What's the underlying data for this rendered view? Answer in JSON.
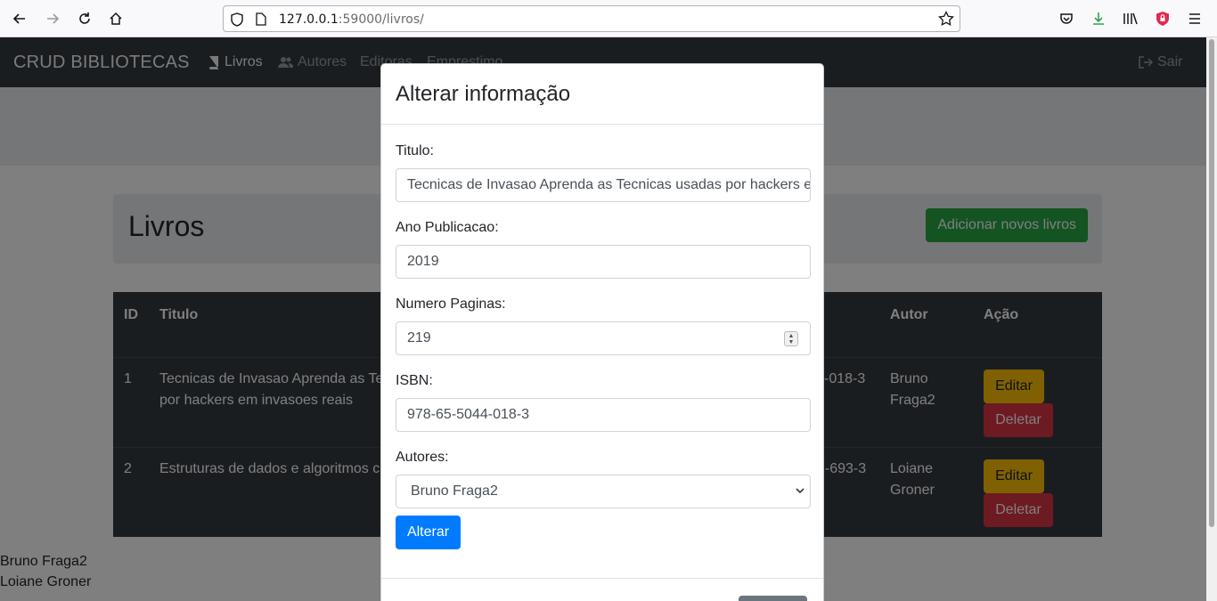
{
  "browser": {
    "url_host": "127.0.0.1",
    "url_rest": ":59000/livros/"
  },
  "navbar": {
    "brand": "CRUD BIBLIOTECAS",
    "links": [
      {
        "label": "Livros",
        "icon": "book-icon",
        "active": true
      },
      {
        "label": "Autores",
        "icon": "users-icon",
        "active": false
      },
      {
        "label": "Editoras",
        "icon": "",
        "active": false
      },
      {
        "label": "Emprestimo",
        "icon": "",
        "active": false
      }
    ],
    "logout": "Sair"
  },
  "jumbotron": {
    "title": "Livros",
    "add_button": "Adicionar novos livros"
  },
  "table": {
    "headers": [
      "ID",
      "Titulo",
      "Autor",
      "Ação"
    ],
    "rows": [
      {
        "id": "1",
        "titulo_line1": "Tecnicas de Invasao Aprenda as Te",
        "titulo_line2": "por hackers em invasoes reais",
        "isbn_tail": "-018-3",
        "autor_line1": "Bruno",
        "autor_line2": "Fraga2"
      },
      {
        "id": "2",
        "titulo_line1": "Estruturas de dados e algoritmos c",
        "titulo_line2": "",
        "isbn_tail": "2-693-3",
        "autor_line1": "Loiane",
        "autor_line2": "Groner"
      }
    ],
    "edit_label": "Editar",
    "delete_label": "Deletar"
  },
  "bottom_list": [
    "Bruno Fraga2",
    "Loiane Groner"
  ],
  "modal": {
    "title": "Alterar informação",
    "fields": {
      "titulo_label": "Titulo:",
      "titulo_value": "Tecnicas de Invasao Aprenda as Tecnicas usadas por hackers em invasoes reais",
      "ano_label": "Ano Publicacao:",
      "ano_value": "2019",
      "paginas_label": "Numero Paginas:",
      "paginas_value": "219",
      "isbn_label": "ISBN:",
      "isbn_value": "978-65-5044-018-3",
      "autores_label": "Autores:",
      "autores_value": "Bruno Fraga2"
    },
    "submit_label": "Alterar"
  },
  "colors": {
    "navbar": "#343a40",
    "success": "#28a745",
    "warning": "#ffc107",
    "danger": "#dc3545",
    "primary": "#007bff"
  }
}
